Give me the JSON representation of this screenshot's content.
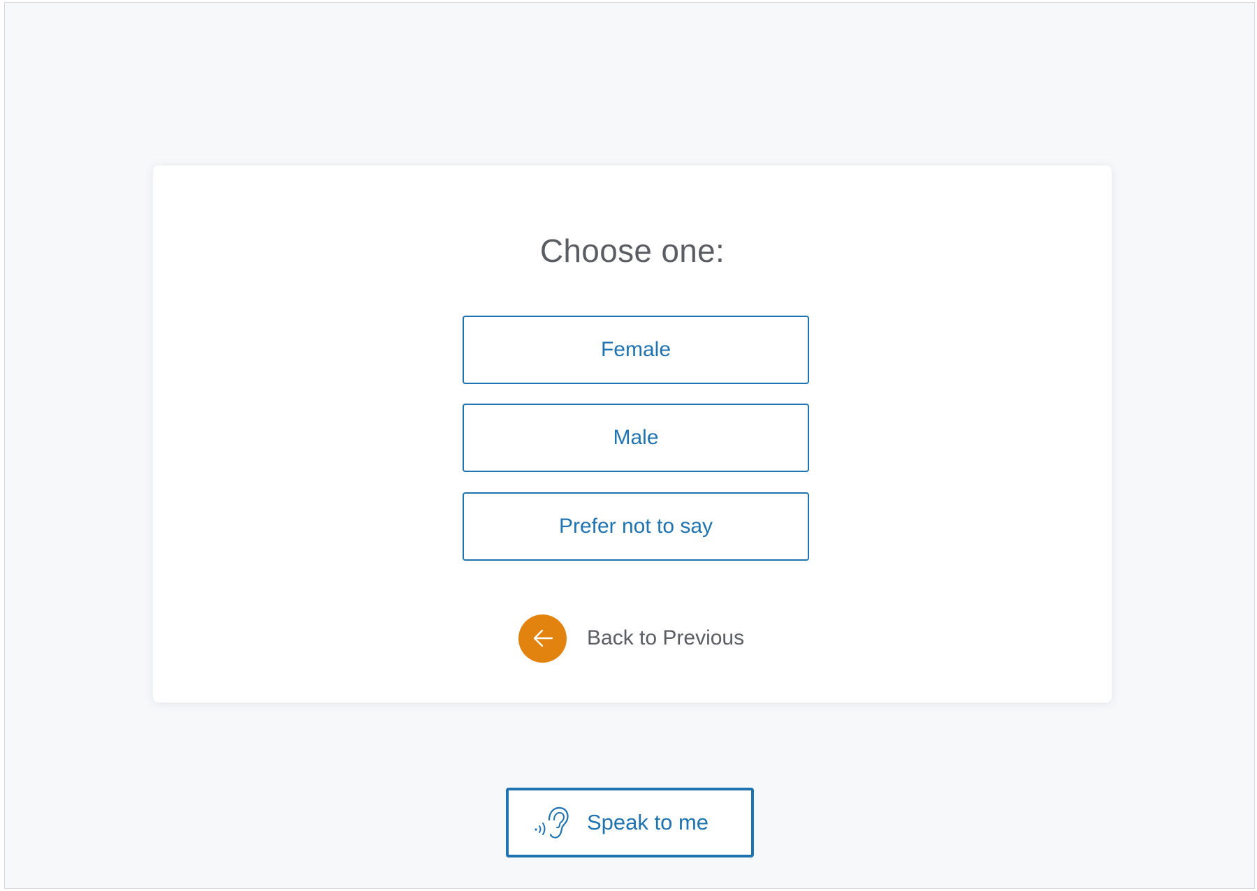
{
  "question": {
    "title": "Choose one:"
  },
  "options": [
    {
      "label": "Female"
    },
    {
      "label": "Male"
    },
    {
      "label": "Prefer not to say"
    }
  ],
  "navigation": {
    "back_label": "Back to Previous",
    "back_icon": "arrow-left-icon"
  },
  "accessibility": {
    "speak_label": "Speak to me",
    "speak_icon": "ear-sound-icon"
  },
  "colors": {
    "accent": "#1f73b0",
    "back_button": "#e2820f",
    "text_muted": "#5b5d63",
    "page_background": "#f7f8fa"
  }
}
